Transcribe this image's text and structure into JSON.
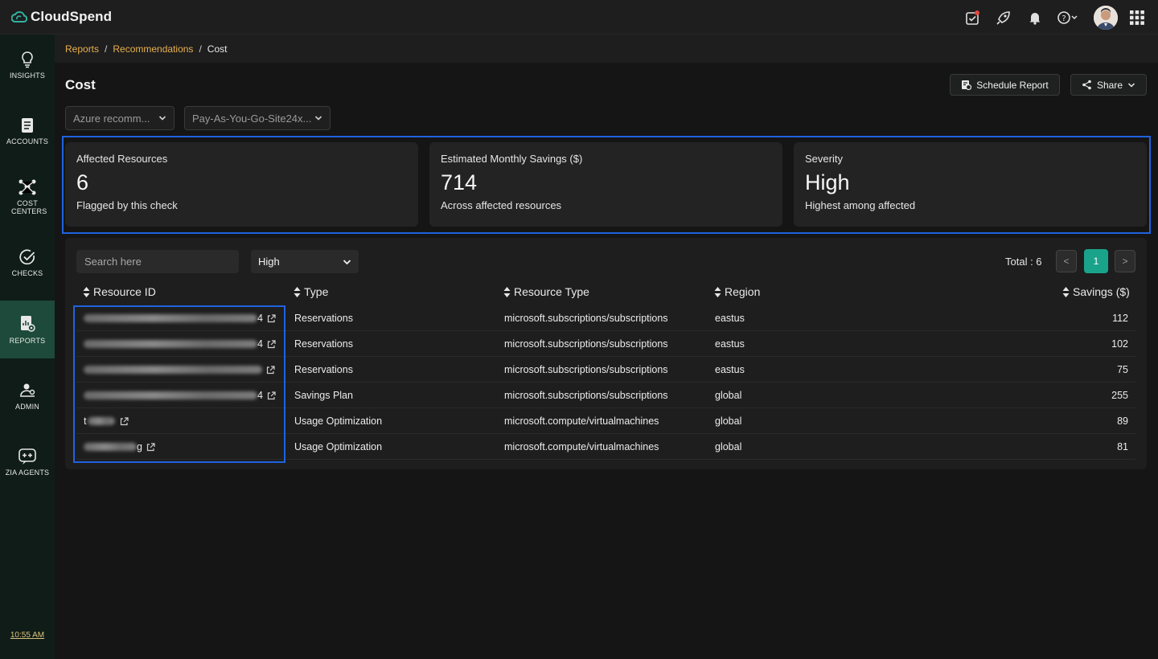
{
  "app": {
    "name": "CloudSpend",
    "brand_color": "#2fb5a0"
  },
  "topbar": {
    "icons": [
      "task-icon",
      "rocket-icon",
      "bell-icon",
      "help-icon",
      "avatar",
      "apps-grid-icon"
    ]
  },
  "sidebar": {
    "items": [
      {
        "label": "INSIGHTS",
        "icon": "bulb-icon"
      },
      {
        "label": "ACCOUNTS",
        "icon": "accounts-icon"
      },
      {
        "label": "COST CENTERS",
        "icon": "cost-centers-icon"
      },
      {
        "label": "CHECKS",
        "icon": "check-icon"
      },
      {
        "label": "REPORTS",
        "icon": "reports-icon",
        "active": true
      },
      {
        "label": "ADMIN",
        "icon": "admin-icon"
      },
      {
        "label": "ZIA AGENTS",
        "icon": "zia-agents-icon"
      }
    ],
    "time": "10:55 AM"
  },
  "breadcrumb": {
    "items": [
      "Reports",
      "Recommendations"
    ],
    "current": "Cost",
    "sep": "/"
  },
  "page": {
    "title": "Cost",
    "schedule_label": "Schedule Report",
    "share_label": "Share",
    "filter_provider": "Azure recomm...",
    "filter_account": "Pay-As-You-Go-Site24x..."
  },
  "summary": {
    "affected": {
      "label": "Affected Resources",
      "value": "6",
      "sub": "Flagged by this check"
    },
    "savings": {
      "label": "Estimated Monthly Savings ($)",
      "value": "714",
      "sub": "Across affected resources"
    },
    "severity": {
      "label": "Severity",
      "value": "High",
      "sub": "Highest among affected"
    }
  },
  "table": {
    "search_placeholder": "Search here",
    "severity_filter": "High",
    "total_label": "Total : 6",
    "current_page": "1",
    "prev": "<",
    "next": ">",
    "columns": [
      "Resource ID",
      "Type",
      "Resource Type",
      "Region",
      "Savings ($)"
    ],
    "rows": [
      {
        "id_suffix": "4",
        "type": "Reservations",
        "resource_type": "microsoft.subscriptions/subscriptions",
        "region": "eastus",
        "savings": "112"
      },
      {
        "id_suffix": "4",
        "type": "Reservations",
        "resource_type": "microsoft.subscriptions/subscriptions",
        "region": "eastus",
        "savings": "102"
      },
      {
        "id_suffix": "",
        "type": "Reservations",
        "resource_type": "microsoft.subscriptions/subscriptions",
        "region": "eastus",
        "savings": "75"
      },
      {
        "id_suffix": "4",
        "type": "Savings Plan",
        "resource_type": "microsoft.subscriptions/subscriptions",
        "region": "global",
        "savings": "255"
      },
      {
        "id_suffix": "t",
        "type": "Usage Optimization",
        "resource_type": "microsoft.compute/virtualmachines",
        "region": "global",
        "savings": "89"
      },
      {
        "id_suffix": "g",
        "type": "Usage Optimization",
        "resource_type": "microsoft.compute/virtualmachines",
        "region": "global",
        "savings": "81"
      }
    ]
  }
}
